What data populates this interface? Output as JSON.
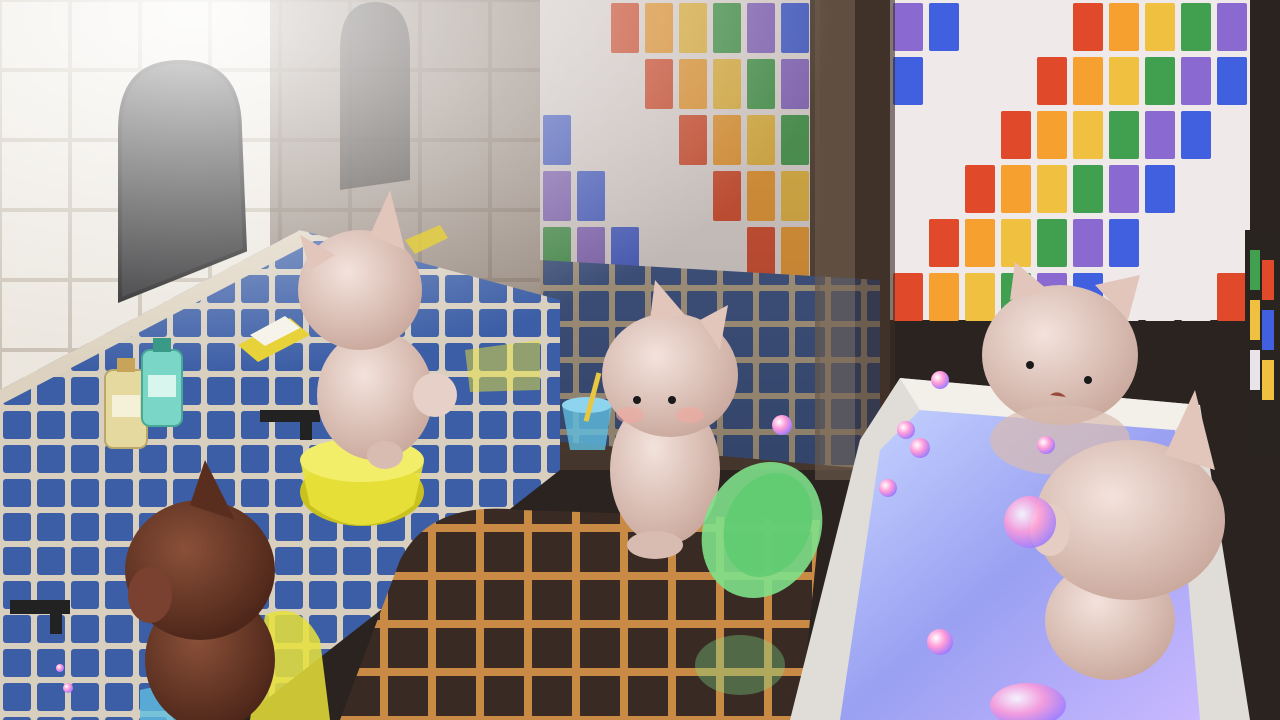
{
  "scene": {
    "subject": "bathhouse-with-cats",
    "palette": {
      "wall_tile": "#e9e4dc",
      "blue_tile": "#3d5fa8",
      "grout": "#cfc7b6",
      "cat_fur": "#e6c9bf",
      "cat_dark": "#6b3a2a",
      "bucket_yellow": "#e8e23a",
      "bucket_green": "#7fe08a",
      "cup_blue": "#5fbde0",
      "water": "#9aa8f0",
      "floor_dark": "#3a2a22",
      "glass_window_red": "#e04a2a",
      "glass_window_yellow": "#f0c040",
      "glass_window_purple": "#8a6ad0"
    }
  }
}
